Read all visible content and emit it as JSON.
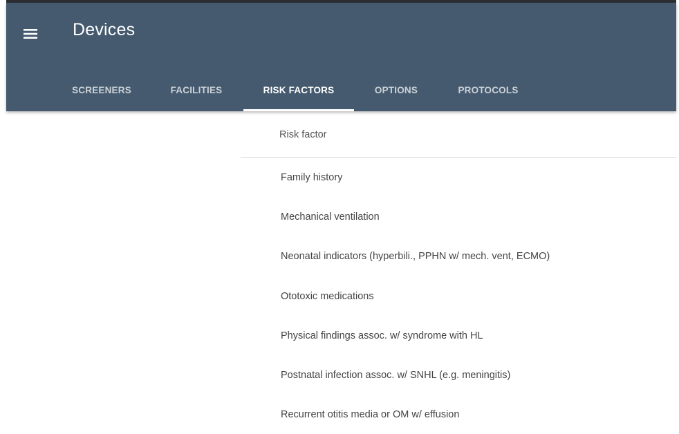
{
  "app": {
    "title": "Devices",
    "menu_icon": "menu-icon"
  },
  "colors": {
    "appbar": "#455a6f",
    "tab_indicator": "#ffffff"
  },
  "tabs": [
    {
      "label": "SCREENERS",
      "active": false
    },
    {
      "label": "FACILITIES",
      "active": false
    },
    {
      "label": "RISK FACTORS",
      "active": true
    },
    {
      "label": "OPTIONS",
      "active": false
    },
    {
      "label": "PROTOCOLS",
      "active": false
    }
  ],
  "table": {
    "header": "Risk factor",
    "rows": [
      "Family history",
      "Mechanical ventilation",
      "Neonatal indicators (hyperbili., PPHN w/ mech. vent, ECMO)",
      "Ototoxic medications",
      "Physical findings assoc. w/ syndrome with HL",
      "Postnatal infection assoc. w/ SNHL (e.g. meningitis)",
      "Recurrent otitis media or OM w/ effusion"
    ]
  }
}
